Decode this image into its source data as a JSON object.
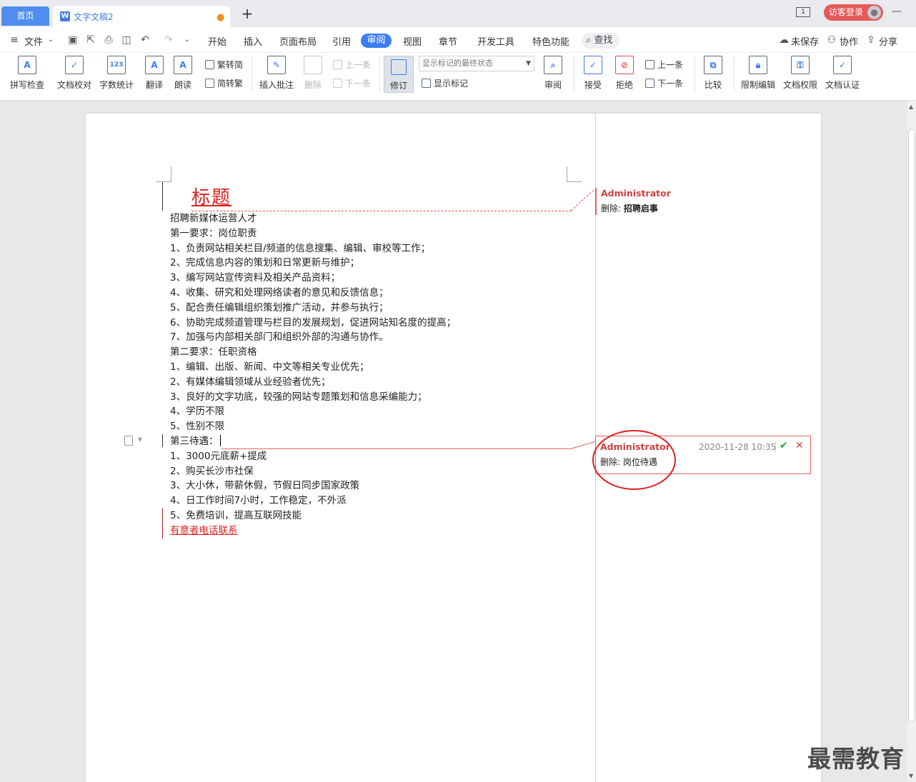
{
  "tabs": {
    "home": "首页",
    "document": "文字文稿2",
    "add": "+"
  },
  "window": {
    "layout_badge": "1",
    "login": "访客登录",
    "minimize": "—"
  },
  "menu": {
    "file": "文件",
    "items": [
      "开始",
      "插入",
      "页面布局",
      "引用",
      "审阅",
      "视图",
      "章节",
      "开发工具",
      "特色功能"
    ],
    "active": "审阅",
    "search": "查找",
    "unsaved": "未保存",
    "collab": "协作",
    "share": "分享"
  },
  "ribbon": {
    "spellcheck": "拼写检查",
    "doc_proof": "文档校对",
    "word_count": "字数统计",
    "translate": "翻译",
    "read_aloud": "朗读",
    "trad_to_simp": "繁转简",
    "simp_to_trad": "简转繁",
    "insert_comment": "插入批注",
    "delete": "删除",
    "prev_comment": "上一条",
    "next_comment": "下一条",
    "track_changes": "修订",
    "markup_state": "显示标记的最终状态",
    "show_markup": "显示标记",
    "review": "审阅",
    "accept": "接受",
    "reject": "拒绝",
    "prev_change": "上一条",
    "next_change": "下一条",
    "compare": "比较",
    "restrict_edit": "限制编辑",
    "doc_permission": "文档权限",
    "doc_certify": "文档认证"
  },
  "document": {
    "title": "标题",
    "lines": [
      "招聘新媒体运营人才",
      "第一要求：岗位职责",
      "1、负责网站相关栏目/频道的信息搜集、编辑、审校等工作；",
      "2、完成信息内容的策划和日常更新与维护；",
      "3、编写网站宣传资料及相关产品资料；",
      "4、收集、研究和处理网络读者的意见和反馈信息；",
      "5、配合责任编辑组织策划推广活动，并参与执行；",
      "6、协助完成频道管理与栏目的发展规划，促进网站知名度的提高；",
      "7、加强与内部相关部门和组织外部的沟通与协作。",
      "第二要求：任职资格",
      "1、编辑、出版、新闻、中文等相关专业优先；",
      "2、有媒体编辑领域从业经验者优先；",
      "3、良好的文字功底，较强的网站专题策划和信息采编能力；",
      "4、学历不限",
      "5、性别不限",
      "第三待遇：",
      "1、3000元底薪+提成",
      "2、购买长沙市社保",
      "3、大小休，带薪休假，节假日同步国家政策",
      "4、日工作时间7小时，工作稳定，不外派",
      "5、免费培训，提高互联网技能",
      "有意者电话联系"
    ]
  },
  "comments": [
    {
      "author": "Administrator",
      "action": "删除:",
      "content": "招聘启事"
    },
    {
      "author": "Administrator",
      "time": "2020-11-28 10:35",
      "action": "删除:",
      "content": "岗位待遇"
    }
  ],
  "watermark": "最需教育",
  "colors": {
    "accent": "#3b7cf0",
    "revision": "#e02020"
  }
}
